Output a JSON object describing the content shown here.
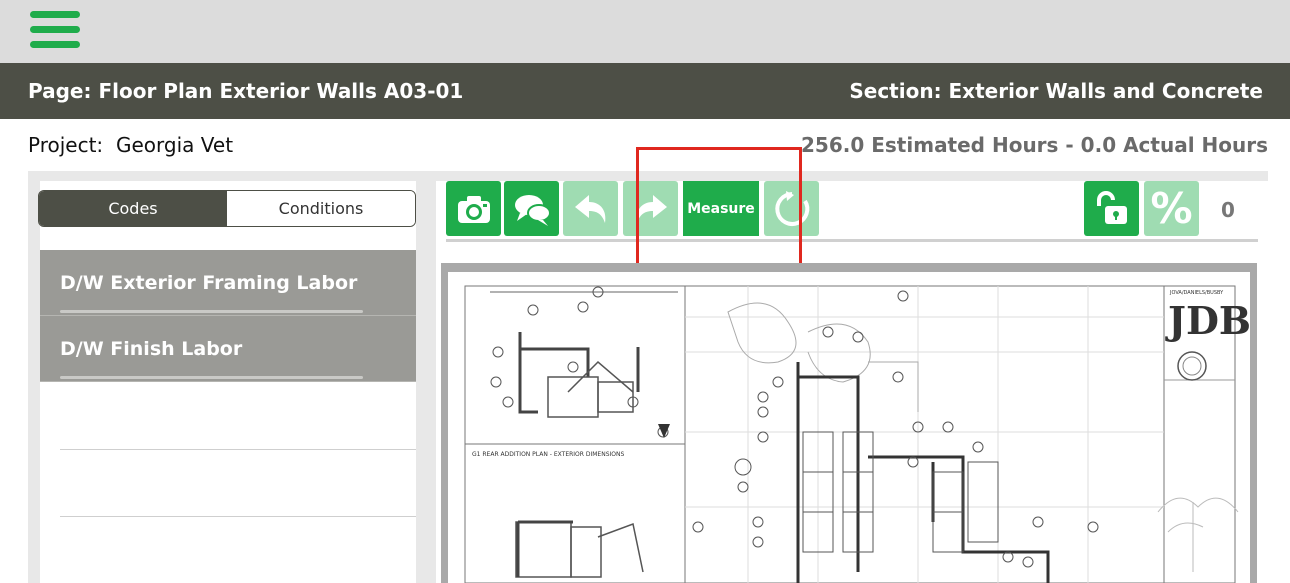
{
  "header": {
    "menu_icon": "hamburger-icon",
    "page_title": "Page: Floor Plan Exterior Walls A03-01",
    "section_title": "Section: Exterior Walls and Concrete"
  },
  "project": {
    "label": "Project:",
    "name": "Georgia Vet",
    "hours": "256.0 Estimated Hours - 0.0 Actual Hours"
  },
  "tabs": {
    "codes": "Codes",
    "conditions": "Conditions",
    "active": "codes"
  },
  "codes": [
    {
      "label": "D/W Exterior Framing Labor"
    },
    {
      "label": "D/W Finish Labor"
    }
  ],
  "toolbar": {
    "camera_icon": "camera-icon",
    "comments_icon": "comments-icon",
    "undo_icon": "undo-icon",
    "redo_icon": "redo-icon",
    "measure_label": "Measure",
    "refresh_icon": "refresh-icon",
    "lock_icon": "unlock-icon",
    "percent_label": "%",
    "count": "0"
  },
  "drawing": {
    "title_block_text": "JOVA/DANIELS/BUSBY",
    "logo_text": "JDB",
    "detail_label": "G1 REAR ADDITION PLAN - EXTERIOR DIMENSIONS"
  },
  "colors": {
    "accent_green": "#1fac4b",
    "disabled_green": "#9fdcb2",
    "header_dark": "#4d4f46",
    "list_gray": "#9a9a96",
    "highlight_red": "#e0281f"
  }
}
